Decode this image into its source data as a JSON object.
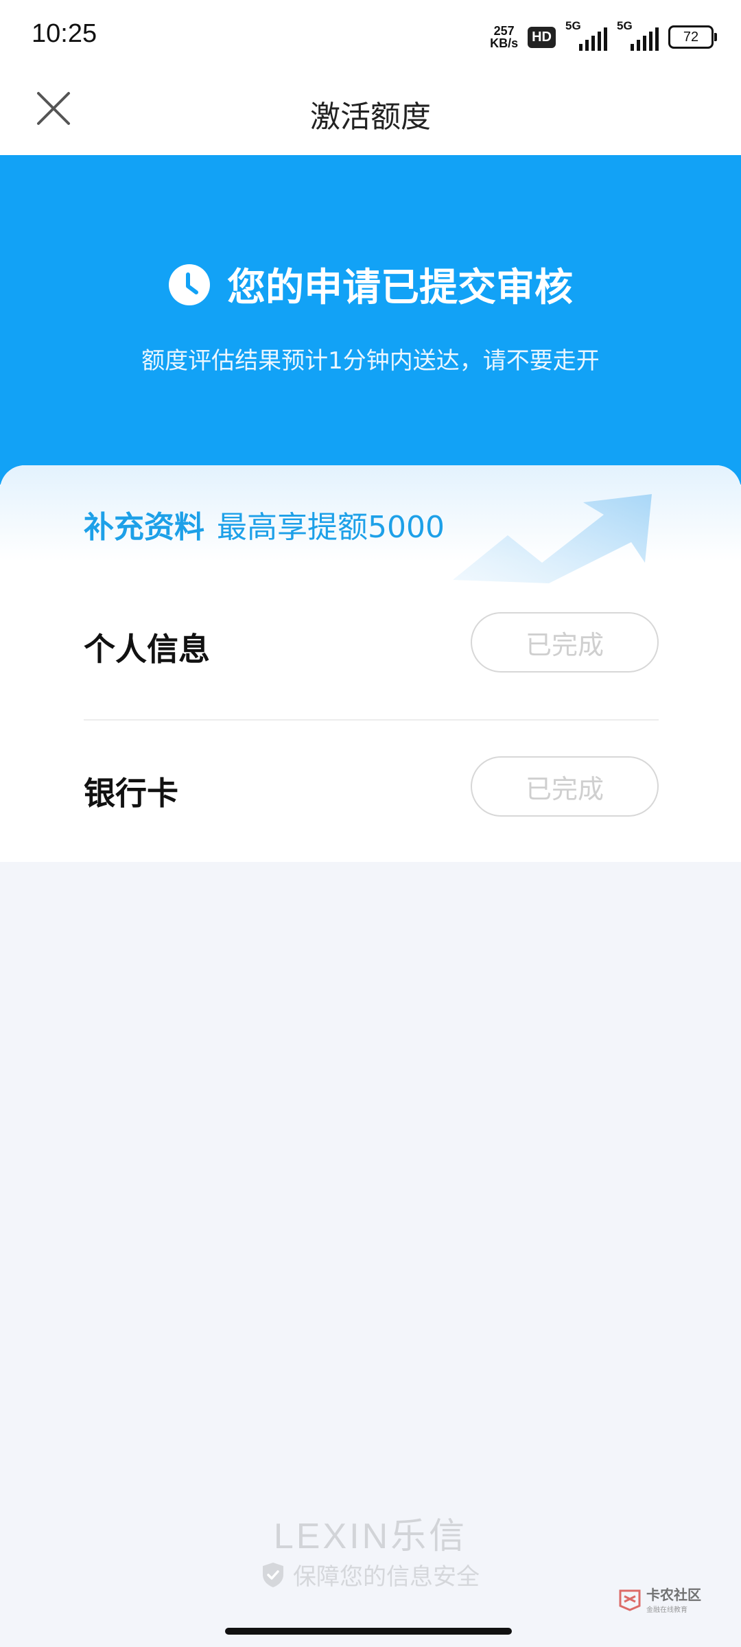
{
  "status_bar": {
    "time": "10:25",
    "net_speed_value": "257",
    "net_speed_unit": "KB/s",
    "hd_badge": "HD",
    "signal1_label": "5G",
    "signal2_label": "5G",
    "battery": "72"
  },
  "nav": {
    "title": "激活额度",
    "close_icon": "close-icon"
  },
  "hero": {
    "icon": "clock-icon",
    "title": "您的申请已提交审核",
    "subtitle": "额度评估结果预计1分钟内送达，请不要走开"
  },
  "card": {
    "promo_strong": "补充资料",
    "promo_light": "最高享提额5000",
    "items": [
      {
        "label": "个人信息",
        "status": "已完成"
      },
      {
        "label": "银行卡",
        "status": "已完成"
      }
    ]
  },
  "footer": {
    "logo": "LEXIN乐信",
    "secure_text": "保障您的信息安全",
    "secure_icon": "shield-icon"
  },
  "watermark": {
    "main": "卡农社区",
    "sub": "金融在线教育"
  },
  "colors": {
    "brand_blue": "#12a2f6",
    "promo_blue": "#1da0e8",
    "page_bg": "#f3f5fa"
  }
}
